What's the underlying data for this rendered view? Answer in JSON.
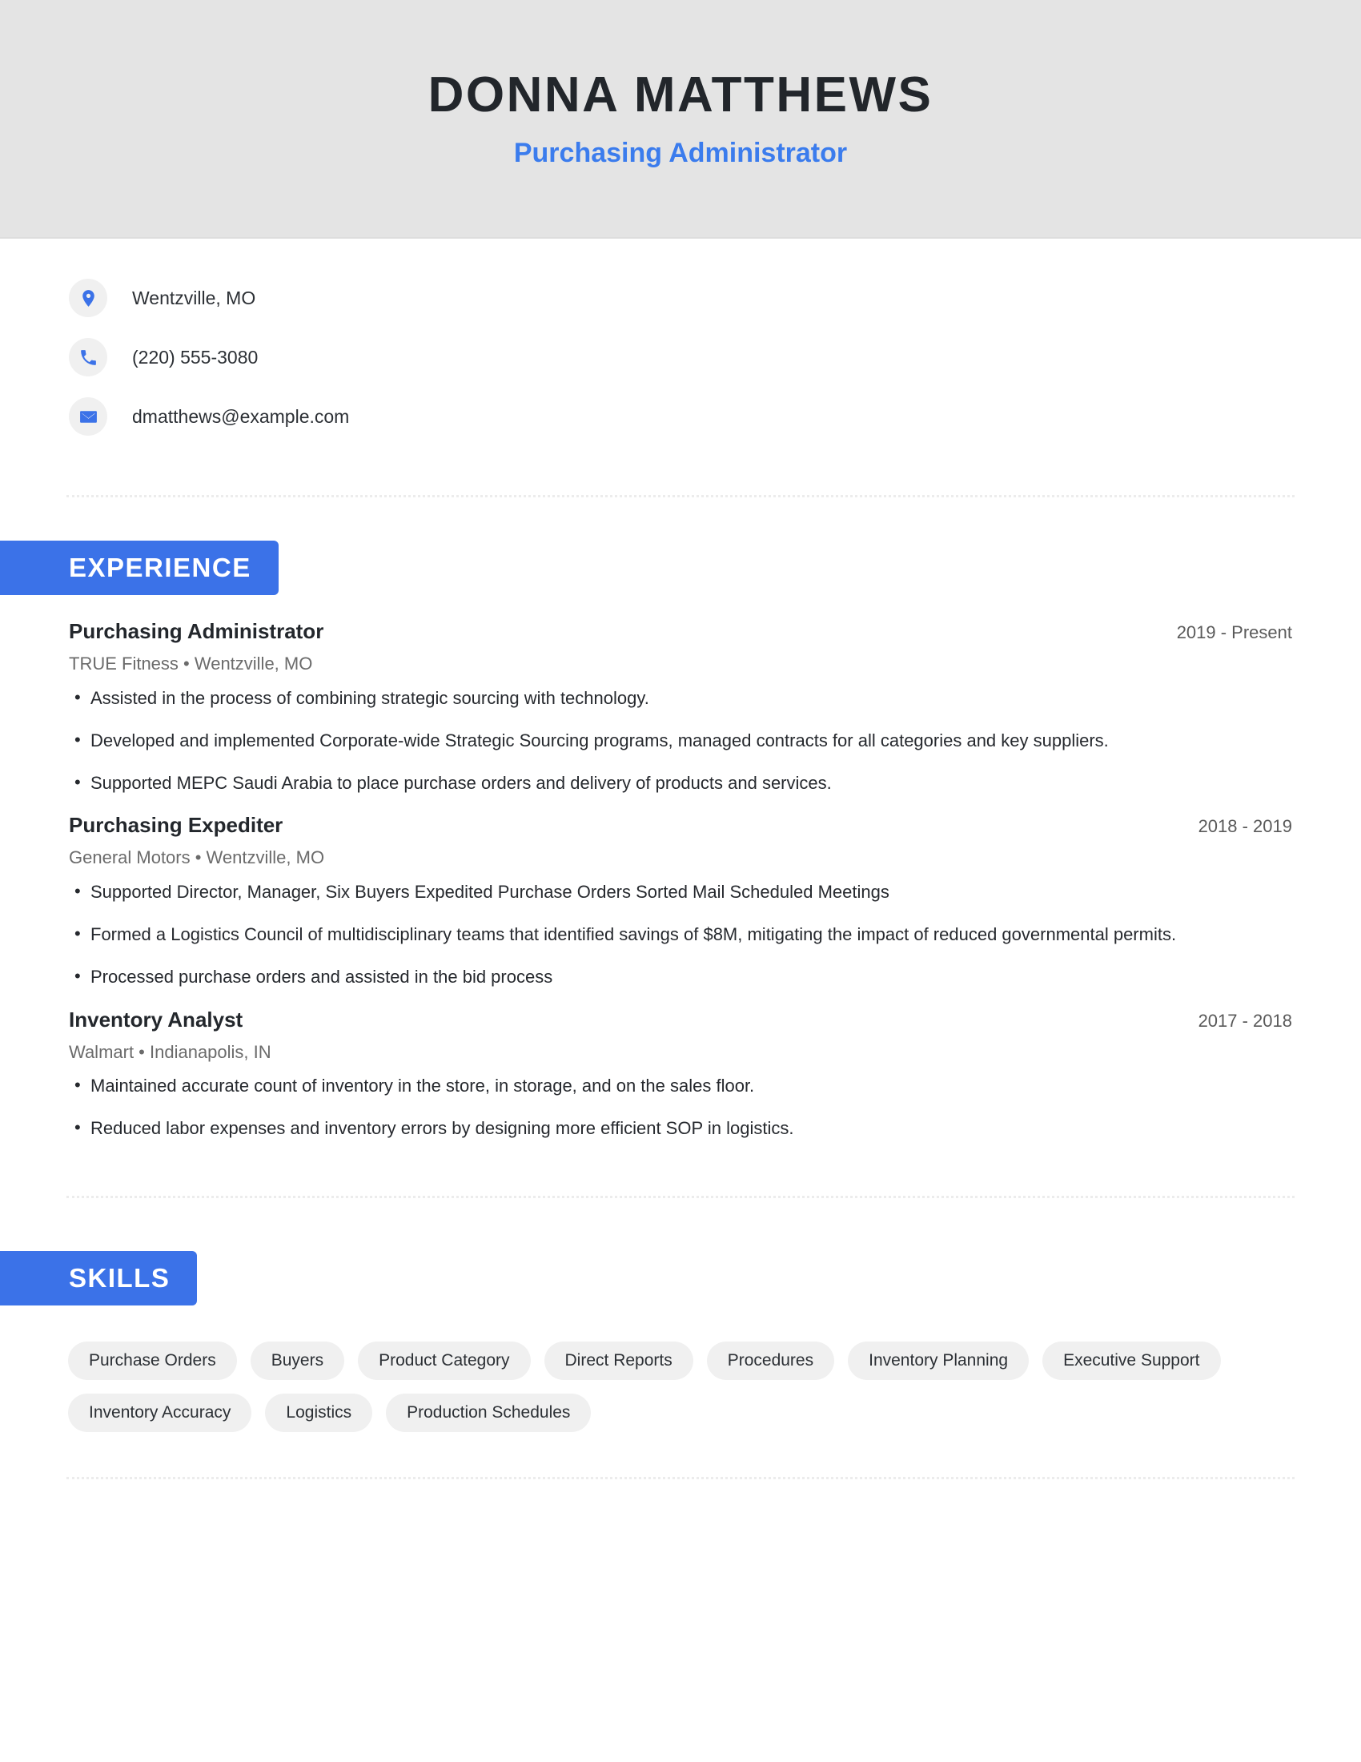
{
  "header": {
    "name": "DONNA MATTHEWS",
    "title": "Purchasing Administrator",
    "background_color": "#e4e4e4",
    "name_color": "#22262b",
    "title_color": "#3b7ced"
  },
  "contact": {
    "items": [
      {
        "icon": "location-pin-icon",
        "value": "Wentzville, MO"
      },
      {
        "icon": "phone-icon",
        "value": "(220) 555-3080"
      },
      {
        "icon": "email-icon",
        "value": "dmatthews@example.com"
      }
    ],
    "icon_color": "#3b72e8",
    "icon_bg_color": "#f0f0f0"
  },
  "sections": {
    "experience": {
      "heading": "EXPERIENCE",
      "accent_color": "#3b72e8",
      "jobs": [
        {
          "role": "Purchasing Administrator",
          "dates": "2019 - Present",
          "organization": "TRUE Fitness  •  Wentzville, MO",
          "bullets": [
            "Assisted in the process of combining strategic sourcing with technology.",
            "Developed and implemented Corporate-wide Strategic Sourcing programs, managed contracts for all categories and key suppliers.",
            "Supported MEPC Saudi Arabia to place purchase orders and delivery of products and services."
          ]
        },
        {
          "role": "Purchasing Expediter",
          "dates": "2018 - 2019",
          "organization": "General Motors  •  Wentzville, MO",
          "bullets": [
            "Supported Director, Manager, Six Buyers Expedited Purchase Orders Sorted Mail Scheduled Meetings",
            "Formed a Logistics Council of multidisciplinary teams that identified savings of $8M, mitigating the impact of reduced governmental permits.",
            "Processed purchase orders and assisted in the bid process"
          ]
        },
        {
          "role": "Inventory Analyst",
          "dates": "2017 - 2018",
          "organization": "Walmart  •  Indianapolis, IN",
          "bullets": [
            "Maintained accurate count of inventory in the store, in storage, and on the sales floor.",
            "Reduced labor expenses and inventory errors by designing more efficient SOP in logistics."
          ]
        }
      ]
    },
    "skills": {
      "heading": "SKILLS",
      "accent_color": "#3b72e8",
      "pill_bg_color": "#f0f0f0",
      "items": [
        "Purchase Orders",
        "Buyers",
        "Product Category",
        "Direct Reports",
        "Procedures",
        "Inventory Planning",
        "Executive Support",
        "Inventory Accuracy",
        "Logistics",
        "Production Schedules"
      ]
    }
  }
}
